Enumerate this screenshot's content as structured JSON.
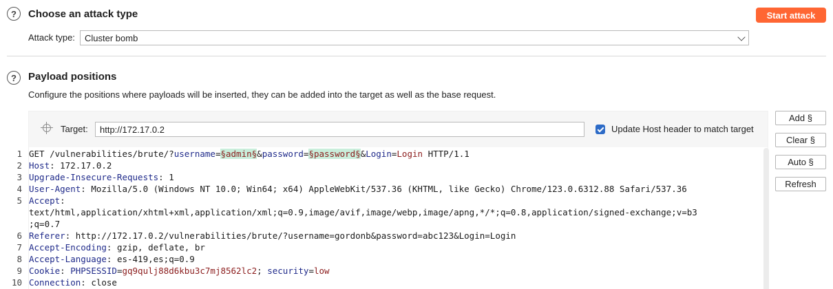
{
  "attack_section": {
    "title": "Choose an attack type",
    "start_label": "Start attack",
    "type_label": "Attack type:",
    "type_value": "Cluster bomb"
  },
  "payload_section": {
    "title": "Payload positions",
    "description": "Configure the positions where payloads will be inserted, they can be added into the target as well as the base request.",
    "target_label": "Target:",
    "target_value": "http://172.17.0.2",
    "update_host_label": "Update Host header to match target",
    "update_host_checked": true
  },
  "side_buttons": {
    "add": "Add §",
    "clear": "Clear §",
    "auto": "Auto §",
    "refresh": "Refresh"
  },
  "request": {
    "line1": {
      "num": "1",
      "pre": "GET /vulnerabilities/brute/?",
      "p1_name": "username",
      "eq1": "=",
      "p1_marker": "§admin§",
      "amp1": "&",
      "p2_name": "password",
      "eq2": "=",
      "p2_marker": "§password§",
      "amp2": "&",
      "p3_name": "Login",
      "eq3": "=",
      "p3_value": "Login",
      "post": " HTTP/1.1"
    },
    "line2": {
      "num": "2",
      "key": "Host",
      "value": ": 172.17.0.2"
    },
    "line3": {
      "num": "3",
      "key": "Upgrade-Insecure-Requests",
      "value": ": 1"
    },
    "line4": {
      "num": "4",
      "key": "User-Agent",
      "value": ": Mozilla/5.0 (Windows NT 10.0; Win64; x64) AppleWebKit/537.36 (KHTML, like Gecko) Chrome/123.0.6312.88 Safari/537.36"
    },
    "line5": {
      "num": "5",
      "key": "Accept",
      "value": ":",
      "cont1": "text/html,application/xhtml+xml,application/xml;q=0.9,image/avif,image/webp,image/apng,*/*;q=0.8,application/signed-exchange;v=b3",
      "cont2": ";q=0.7"
    },
    "line6": {
      "num": "6",
      "key": "Referer",
      "value": ": http://172.17.0.2/vulnerabilities/brute/?username=gordonb&password=abc123&Login=Login"
    },
    "line7": {
      "num": "7",
      "key": "Accept-Encoding",
      "value": ": gzip, deflate, br"
    },
    "line8": {
      "num": "8",
      "key": "Accept-Language",
      "value": ": es-419,es;q=0.9"
    },
    "line9": {
      "num": "9",
      "key": "Cookie",
      "sep": ": ",
      "c1_name": "PHPSESSID",
      "eq1": "=",
      "c1_value": "gq9qulj88d6kbu3c7mj8562lc2",
      "semi": "; ",
      "c2_name": "security",
      "eq2": "=",
      "c2_value": "low"
    },
    "line10": {
      "num": "10",
      "key": "Connection",
      "value": ": close"
    }
  },
  "colors": {
    "accent_button": "#ff6633",
    "checkbox": "#2d6bc7",
    "payload_marker_bg": "#c9eedb",
    "header_key": "#1f2a8a",
    "param_value": "#8b1c1c"
  }
}
